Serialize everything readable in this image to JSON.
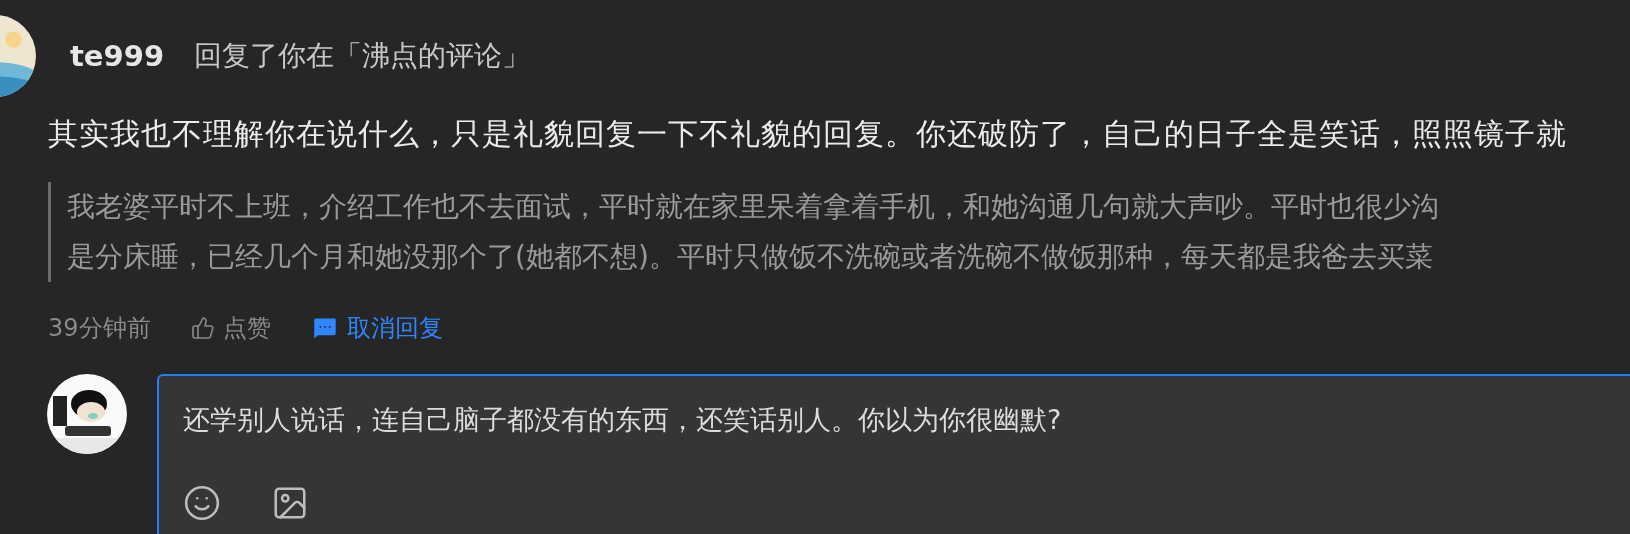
{
  "notification": {
    "username": "te999",
    "action": "回复了你在「沸点的评论」",
    "comment": "其实我也不理解你在说什么，只是礼貌回复一下不礼貌的回复。你还破防了，自己的日子全是笑话，照照镜子就",
    "quote_lines": [
      "我老婆平时不上班，介绍工作也不去面试，平时就在家里呆着拿着手机，和她沟通几句就大声吵。平时也很少沟",
      "是分床睡，已经几个月和她没那个了(她都不想)。平时只做饭不洗碗或者洗碗不做饭那种，每天都是我爸去买菜"
    ],
    "time": "39分钟前",
    "like_label": "点赞",
    "reply_toggle": {
      "label": "取消回复",
      "active": true
    }
  },
  "reply_box": {
    "value": "还学别人说话，连自己脑子都没有的东西，还笑话别人。你以为你很幽默?",
    "focused": true
  }
}
